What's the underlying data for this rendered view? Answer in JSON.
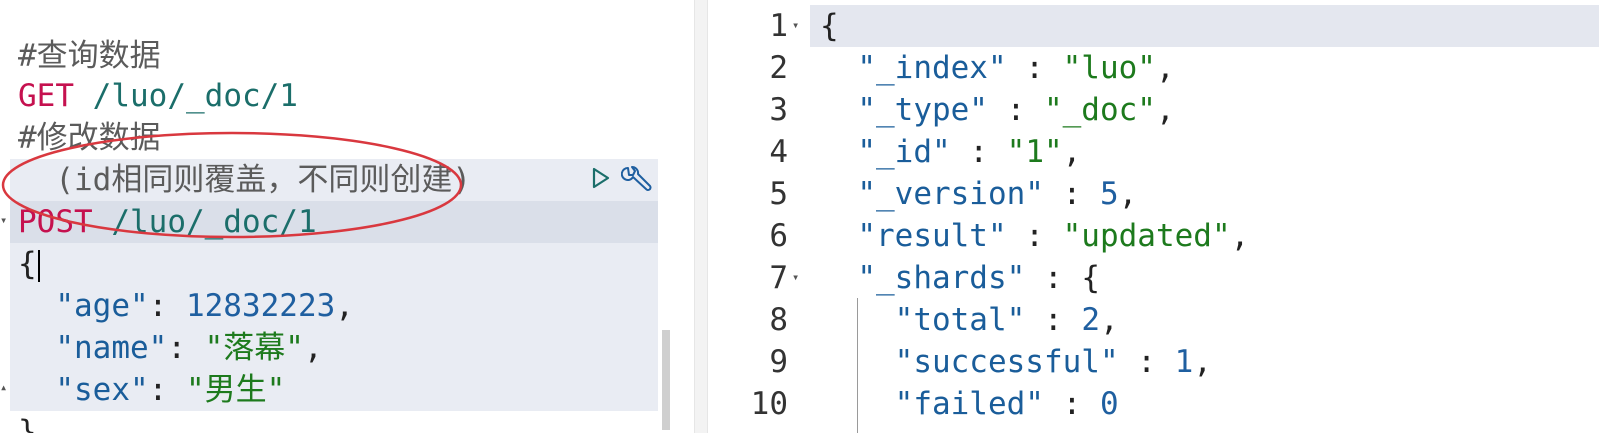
{
  "request_editor": {
    "lines": [
      {
        "type": "comment",
        "text": "#查询数据"
      },
      {
        "type": "method",
        "method": "GET",
        "url": "/luo/_doc/1"
      },
      {
        "type": "comment",
        "text": "#修改数据"
      },
      {
        "type": "comment",
        "text": "  (id相同则覆盖，不同则创建)"
      },
      {
        "type": "method",
        "method": "POST",
        "url": "/luo/_doc/1"
      },
      {
        "type": "brace",
        "text": "{"
      },
      {
        "type": "kv",
        "key": "\"age\"",
        "sep": ": ",
        "value": "12832223",
        "end": ","
      },
      {
        "type": "kv",
        "key": "\"name\"",
        "sep": ": ",
        "value": "\"落幕\"",
        "end": ","
      },
      {
        "type": "kv",
        "key": "\"sex\"",
        "sep": ": ",
        "value": "\"男生\"",
        "end": ""
      },
      {
        "type": "brace",
        "text": "}"
      }
    ],
    "icons": [
      "play-icon",
      "wrench-icon"
    ],
    "highlight_color": "#d9383f"
  },
  "response_viewer": {
    "line_numbers": [
      "1",
      "2",
      "3",
      "4",
      "5",
      "6",
      "7",
      "8",
      "9",
      "10"
    ],
    "lines": [
      {
        "brace": "{"
      },
      {
        "key": "\"_index\"",
        "value": "\"luo\"",
        "end": ","
      },
      {
        "key": "\"_type\"",
        "value": "\"_doc\"",
        "end": ","
      },
      {
        "key": "\"_id\"",
        "value": "\"1\"",
        "end": ","
      },
      {
        "key": "\"_version\"",
        "value": "5",
        "end": ","
      },
      {
        "key": "\"result\"",
        "value": "\"updated\"",
        "end": ","
      },
      {
        "key": "\"_shards\"",
        "value": "{",
        "end": ""
      },
      {
        "key": "\"total\"",
        "value": "2",
        "end": ","
      },
      {
        "key": "\"successful\"",
        "value": "1",
        "end": ","
      },
      {
        "key": "\"failed\"",
        "value": "0",
        "end": ""
      }
    ]
  }
}
